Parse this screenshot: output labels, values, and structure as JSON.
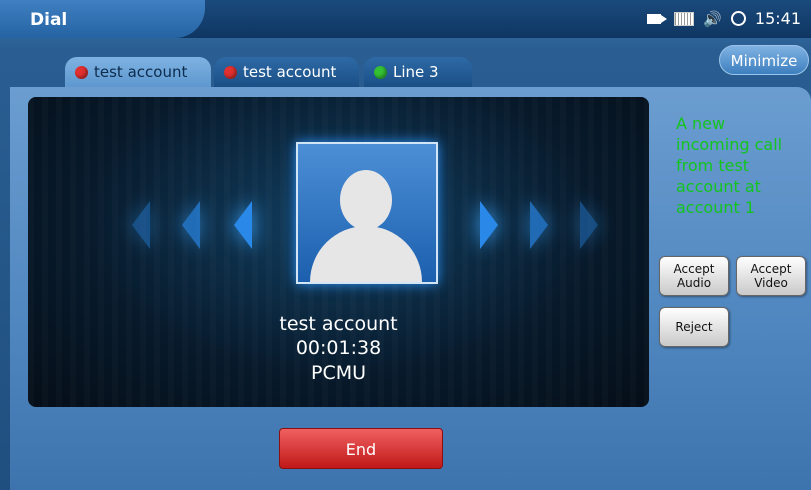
{
  "window": {
    "title": "Dial"
  },
  "status_bar": {
    "icons": [
      "camera-icon",
      "keyboard-icon",
      "speaker-icon",
      "sync-icon"
    ],
    "time": "15:41"
  },
  "tabs": [
    {
      "label": "test account",
      "status": "red",
      "active": true
    },
    {
      "label": "test account",
      "status": "red",
      "active": false
    },
    {
      "label": "Line 3",
      "status": "green",
      "active": false
    }
  ],
  "minimize_label": "Minimize",
  "call": {
    "caller_name": "test account",
    "duration": "00:01:38",
    "codec": "PCMU"
  },
  "incoming": {
    "message": "A new incoming call from test account at account 1"
  },
  "actions": {
    "accept_audio": "Accept\nAudio",
    "accept_video": "Accept\nVideo",
    "reject": "Reject",
    "end": "End"
  },
  "colors": {
    "incoming_text": "#13c41f",
    "end_button": "#d83030",
    "status_red": "#e23030",
    "status_green": "#34c234"
  }
}
